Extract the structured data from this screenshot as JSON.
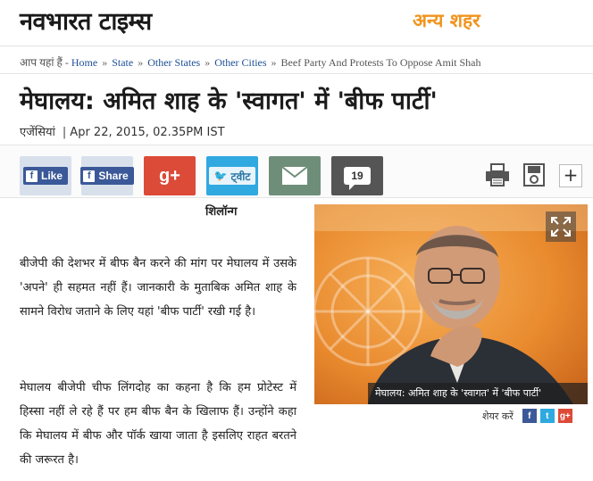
{
  "header": {
    "logo": "नवभारत टाइम्स",
    "section": "अन्य शहर"
  },
  "breadcrumb": {
    "prefix": "आप यहां हैं -",
    "items": [
      "Home",
      "State",
      "Other States",
      "Other Cities"
    ],
    "current": "Beef Party And Protests To Oppose Amit Shah"
  },
  "article": {
    "headline": "मेघालय: अमित शाह के 'स्वागत' में 'बीफ पार्टी'",
    "source": "एजेंसियां",
    "date": "Apr 22, 2015, 02.35PM IST",
    "dateline": "शिलॉन्ग",
    "para1": "बीजेपी की देशभर में बीफ बैन करने की मांग पर मेघालय में उसके 'अपने' ही सहमत नहीं हैं। जानकारी के मुताबिक अमित शाह के सामने विरोध जताने के लिए यहां 'बीफ पार्टी' रखी गई है।",
    "para2": "मेघालय बीजेपी चीफ लिंगदोह का कहना है कि हम प्रोटेस्ट में हिस्सा नहीं ले रहे हैं पर हम बीफ बैन के खिलाफ हैं। उन्होंने कहा कि मेघालय में बीफ और पॉर्क खाया जाता है इसलिए राहत बरतने की जरूरत है।"
  },
  "social": {
    "like": "Like",
    "share": "Share",
    "gplus": "g+",
    "tweet": "ट्वीट",
    "comments": "19"
  },
  "photo": {
    "caption": "मेघालय: अमित शाह के 'स्वागत' में 'बीफ पार्टी'",
    "share_label": "शेयर करें"
  },
  "colors": {
    "logo_accent": "#f0941e",
    "link": "#1d4f96",
    "facebook": "#3b5998",
    "twitter": "#2fa9e0",
    "gplus": "#dc4a38",
    "mail": "#6f8e7a"
  }
}
